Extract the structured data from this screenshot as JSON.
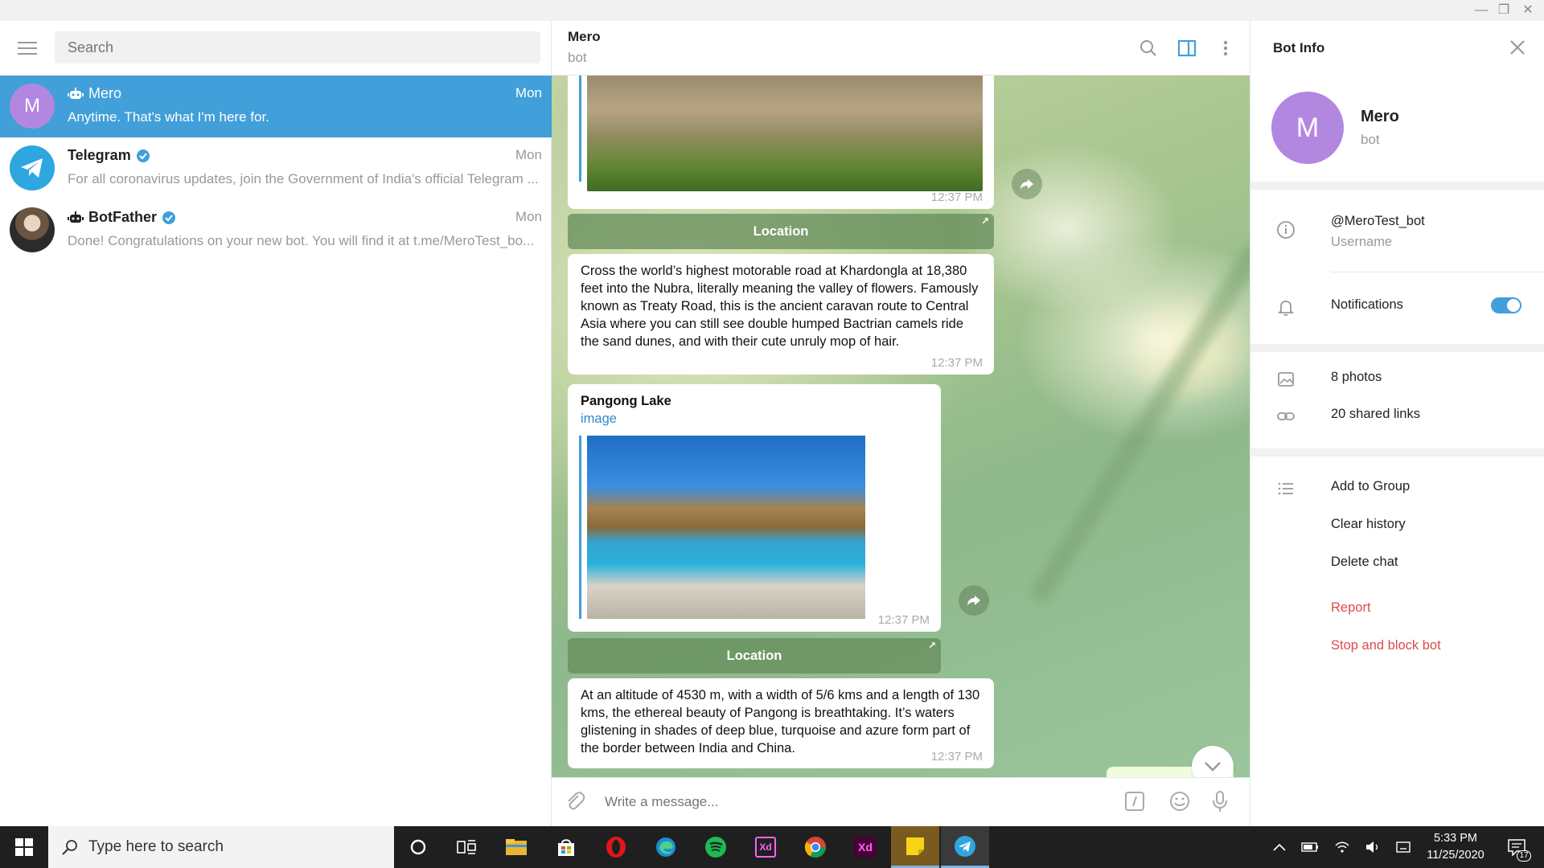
{
  "sidebar": {
    "search_placeholder": "Search",
    "chats": [
      {
        "name": "Mero",
        "time": "Mon",
        "preview": "Anytime. That's what I'm here for.",
        "avatar_letter": "M",
        "avatar_color": "#b287e0"
      },
      {
        "name": "Telegram",
        "time": "Mon",
        "preview": "For all coronavirus updates, join the Government of India's official Telegram ...",
        "avatar_color": "#2ea6df"
      },
      {
        "name": "BotFather",
        "time": "Mon",
        "preview": "Done! Congratulations on your new bot. You will find it at t.me/MeroTest_bo...",
        "avatar_color": "#8c7a6a"
      }
    ]
  },
  "chat": {
    "name": "Mero",
    "status": "bot",
    "messages": {
      "m1_time": "12:37 PM",
      "location_label": "Location",
      "m2_text": "Cross the world’s highest motorable road at Khardongla at 18,380 feet into the Nubra, literally meaning the valley of flowers. Famously known as Treaty Road, this is the ancient caravan route to Central Asia where you can still see double humped Bactrian camels ride the sand dunes, and with their cute unruly mop of hair.",
      "m2_time": "12:37 PM",
      "m3_title": "Pangong Lake",
      "m3_link": "image",
      "m3_time": "12:37 PM",
      "location2_label": "Location",
      "m4_text": "At an altitude of 4530 m, with a width of 5/6 kms and a length of 130 kms, the ethereal beauty of Pangong is breathtaking. It’s waters glistening in shades of deep blue, turquoise and azure form part of the border between India and China.",
      "m4_time": "12:37 PM"
    },
    "composer_placeholder": "Write a message..."
  },
  "info": {
    "title": "Bot Info",
    "name": "Mero",
    "status": "bot",
    "avatar_letter": "M",
    "username": "@MeroTest_bot",
    "username_label": "Username",
    "notifications_label": "Notifications",
    "notifications_on": true,
    "photos": "8 photos",
    "links": "20 shared links",
    "add_to_group": "Add to Group",
    "clear_history": "Clear history",
    "delete_chat": "Delete chat",
    "report": "Report",
    "stop_block": "Stop and block bot"
  },
  "taskbar": {
    "search_placeholder": "Type here to search",
    "time": "5:33 PM",
    "date": "11/25/2020",
    "notification_count": "17"
  },
  "colors": {
    "accent": "#419fd9",
    "danger": "#e04a4a"
  }
}
